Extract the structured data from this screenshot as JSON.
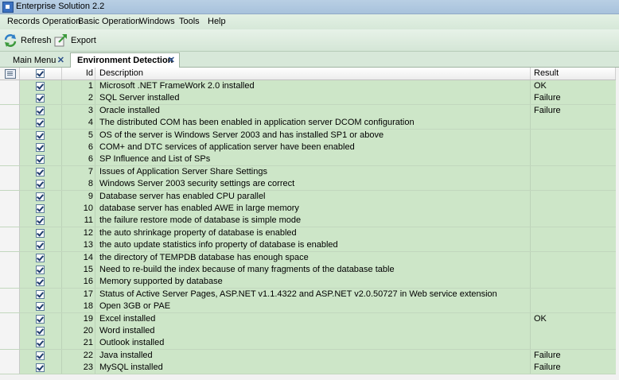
{
  "window": {
    "title": "Enterprise Solution  2.2"
  },
  "menu": [
    "Records Operation",
    "Basic Operation",
    "Windows",
    "Tools",
    "Help"
  ],
  "toolbar": {
    "refresh_label": "Refresh",
    "export_label": "Export"
  },
  "tabs": [
    {
      "label": "Main Menu"
    },
    {
      "label": "Environment Detection"
    }
  ],
  "table": {
    "headers": {
      "id": "Id",
      "description": "Description",
      "result": "Result"
    },
    "rows": [
      {
        "id": "1",
        "description": "Microsoft .NET FrameWork 2.0 installed",
        "result": "OK"
      },
      {
        "id": "2",
        "description": "SQL Server installed",
        "result": "Failure"
      },
      {
        "id": "3",
        "description": "Oracle installed",
        "result": "Failure"
      },
      {
        "id": "4",
        "description": "The distributed COM has been enabled in application server DCOM configuration",
        "result": ""
      },
      {
        "id": "5",
        "description": "OS of the server is Windows Server 2003 and has installed SP1 or above",
        "result": ""
      },
      {
        "id": "6",
        "description": "COM+ and DTC services of application server have been enabled",
        "result": ""
      },
      {
        "id": "6",
        "description": "SP Influence and List of SPs",
        "result": ""
      },
      {
        "id": "7",
        "description": "Issues of Application Server Share Settings",
        "result": ""
      },
      {
        "id": "8",
        "description": "Windows Server 2003 security settings are correct",
        "result": ""
      },
      {
        "id": "9",
        "description": "Database server has enabled CPU parallel",
        "result": ""
      },
      {
        "id": "10",
        "description": "database server has enabled AWE in large memory",
        "result": ""
      },
      {
        "id": "11",
        "description": "the failure restore mode of database is simple mode",
        "result": ""
      },
      {
        "id": "12",
        "description": "the auto shrinkage property of database is enabled",
        "result": ""
      },
      {
        "id": "13",
        "description": "the auto update statistics info property of database is enabled",
        "result": ""
      },
      {
        "id": "14",
        "description": "the directory of TEMPDB database has enough space",
        "result": ""
      },
      {
        "id": "15",
        "description": "Need to re-build the index because of many fragments of the database table",
        "result": ""
      },
      {
        "id": "16",
        "description": "Memory supported by database",
        "result": ""
      },
      {
        "id": "17",
        "description": "Status of Active Server Pages, ASP.NET v1.1.4322 and ASP.NET v2.0.50727 in Web service extension",
        "result": ""
      },
      {
        "id": "18",
        "description": "Open 3GB or PAE",
        "result": ""
      },
      {
        "id": "19",
        "description": "Excel installed",
        "result": "OK"
      },
      {
        "id": "20",
        "description": "Word installed",
        "result": ""
      },
      {
        "id": "21",
        "description": "Outlook installed",
        "result": ""
      },
      {
        "id": "22",
        "description": "Java installed",
        "result": "Failure"
      },
      {
        "id": "23",
        "description": "MySQL installed",
        "result": "Failure"
      }
    ]
  }
}
